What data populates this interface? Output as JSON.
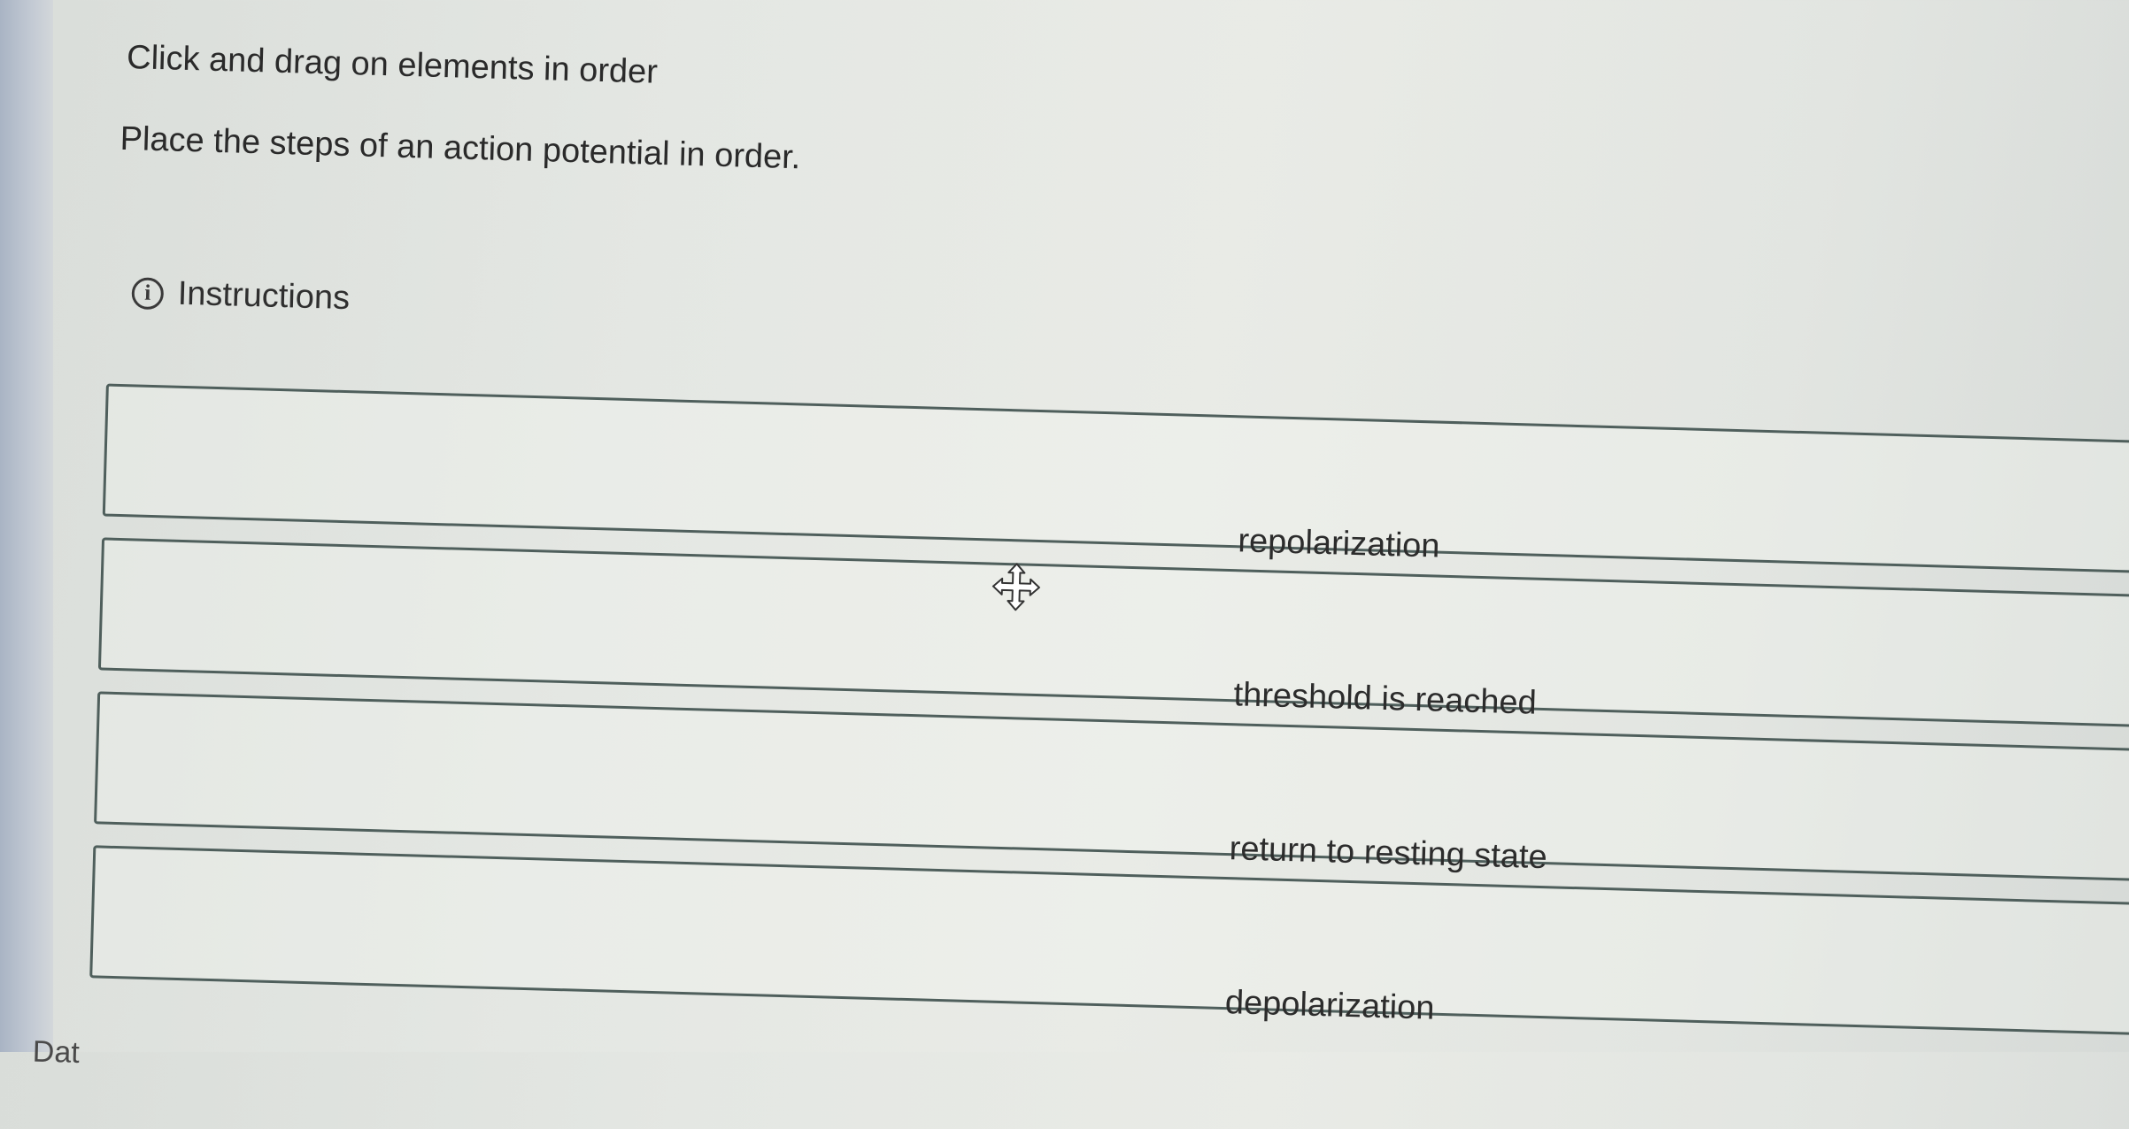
{
  "header": {
    "title": "Click and drag on elements in order",
    "prompt": "Place the steps of an action potential in order."
  },
  "instructions": {
    "label": "Instructions",
    "icon": "info-icon"
  },
  "order_items": [
    {
      "label": "repolarization"
    },
    {
      "label": "threshold is reached"
    },
    {
      "label": "return to resting state"
    },
    {
      "label": "depolarization"
    }
  ],
  "cursor": {
    "icon": "move-cursor-icon"
  },
  "footer": {
    "partial_text": "Dat"
  }
}
